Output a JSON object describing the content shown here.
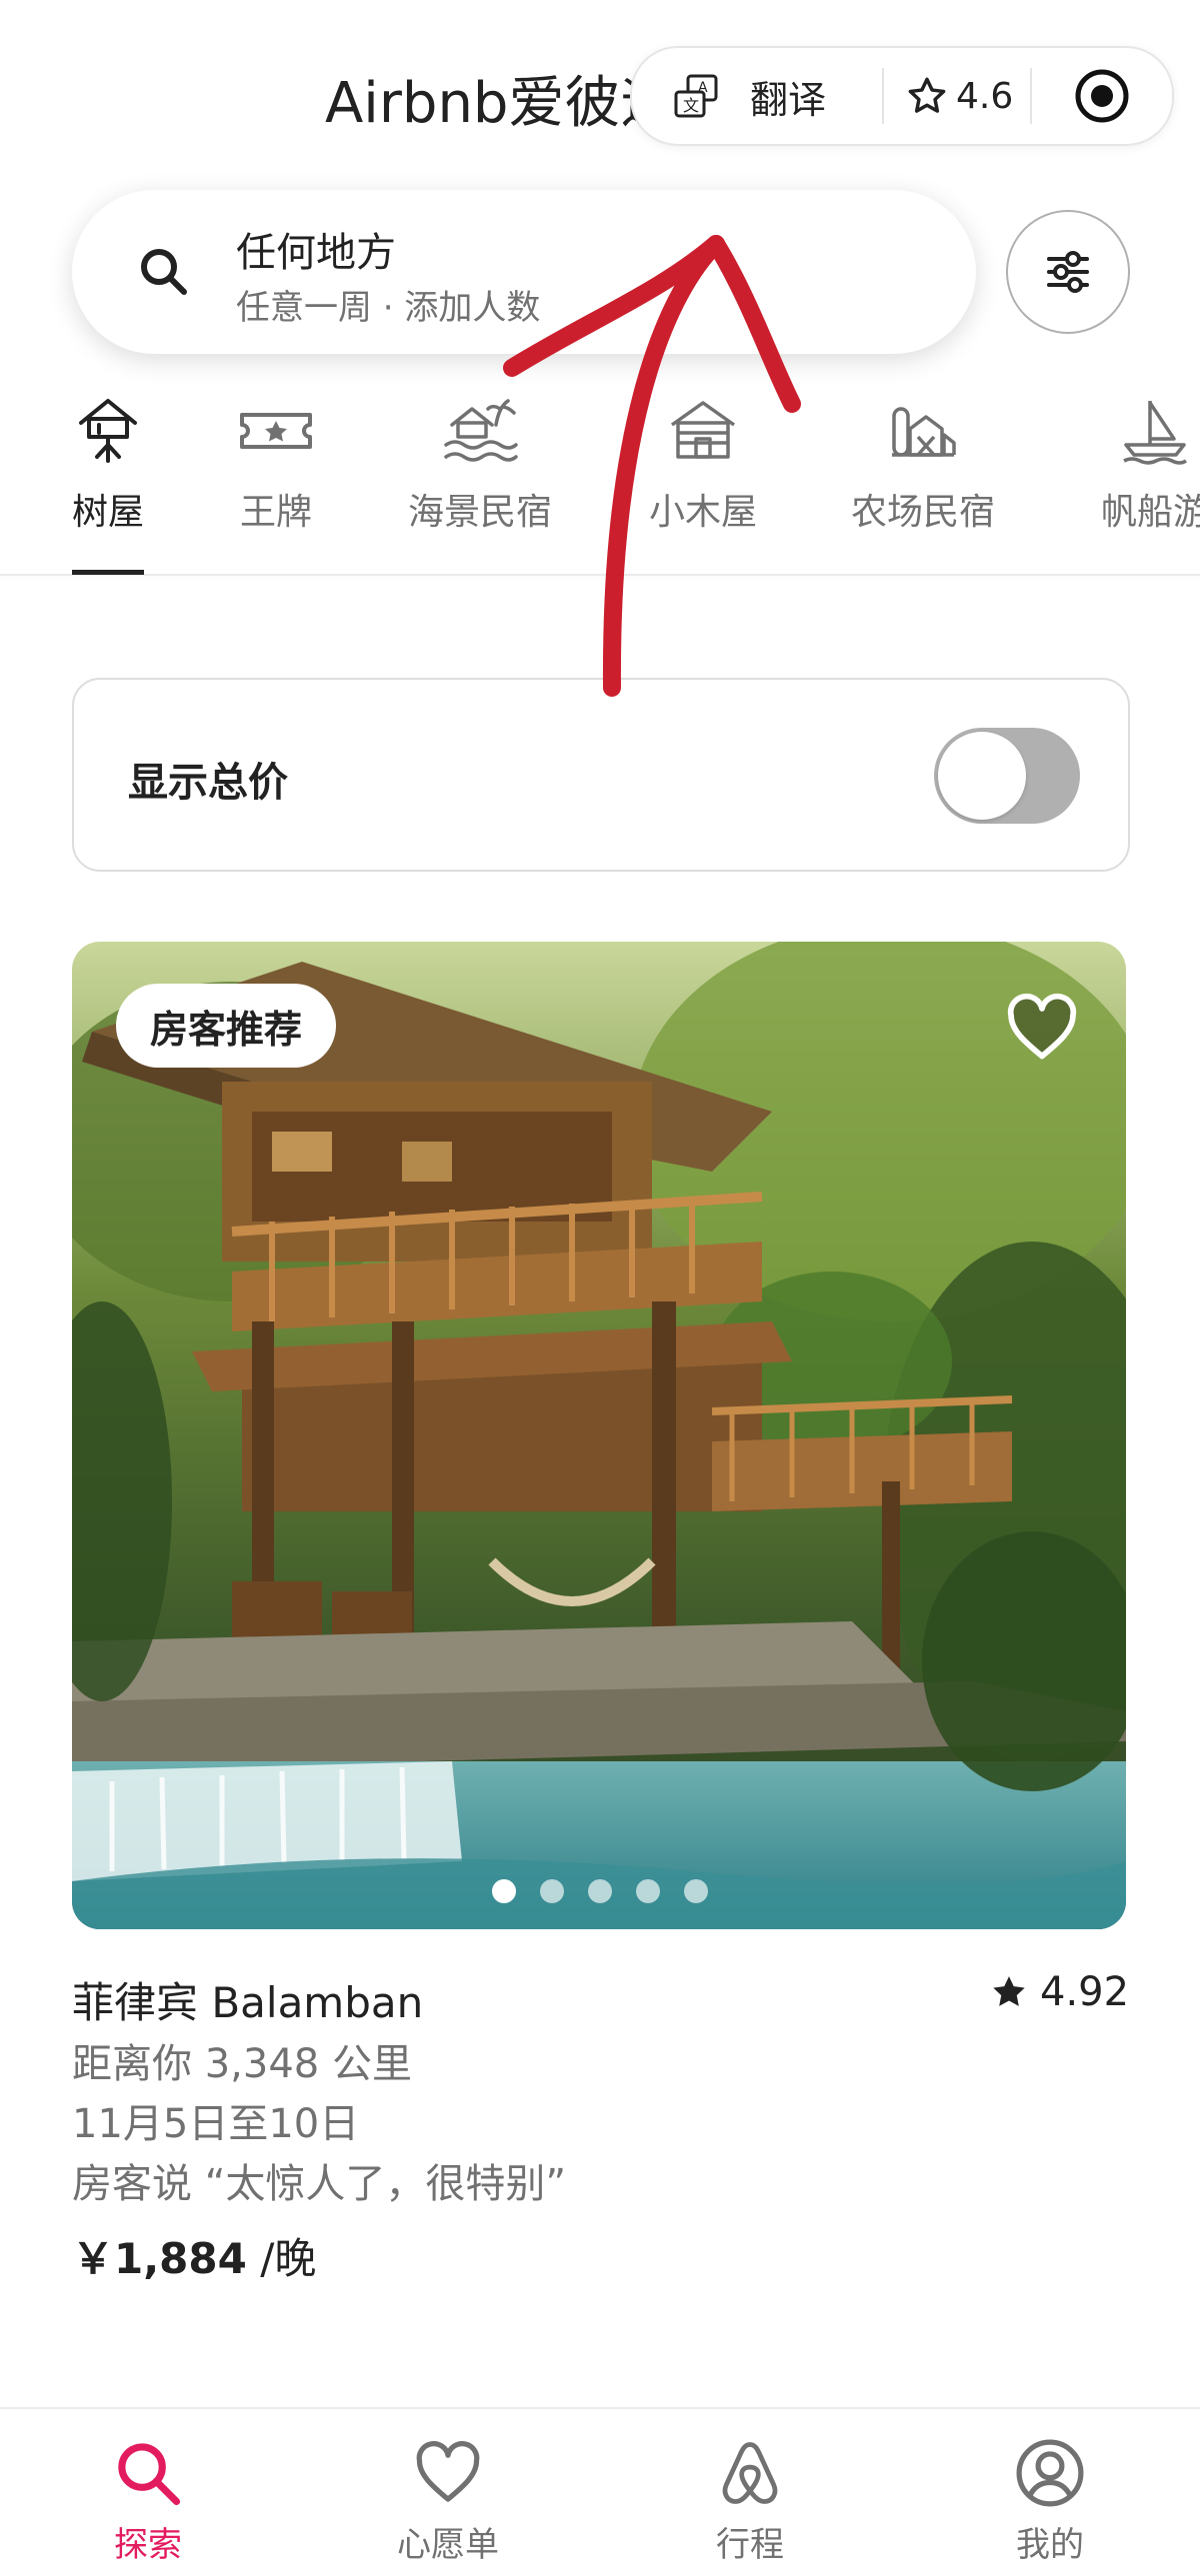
{
  "header": {
    "title": "Airbnb爱彼迎",
    "translate_label": "翻译",
    "rating": "4.6"
  },
  "search": {
    "title": "任何地方",
    "subtitle": "任意一周 · 添加人数"
  },
  "categories": [
    {
      "label": "树屋",
      "icon": "treehouse-icon",
      "active": true
    },
    {
      "label": "王牌",
      "icon": "ticket-star-icon",
      "active": false
    },
    {
      "label": "海景民宿",
      "icon": "beach-house-icon",
      "active": false
    },
    {
      "label": "小木屋",
      "icon": "cabin-icon",
      "active": false
    },
    {
      "label": "农场民宿",
      "icon": "farm-icon",
      "active": false
    },
    {
      "label": "帆船游",
      "icon": "sailboat-icon",
      "active": false
    }
  ],
  "total_price": {
    "label": "显示总价",
    "enabled": false
  },
  "listing": {
    "badge": "房客推荐",
    "location": "菲律宾 Balamban",
    "rating": "4.92",
    "distance": "距离你 3,348 公里",
    "dates": "11月5日至10日",
    "review": "房客说 “太惊人了，很特别”",
    "price": "￥1,884",
    "price_unit": " /晚",
    "photo_count": 5,
    "active_photo": 0
  },
  "nav": [
    {
      "label": "探索",
      "icon": "search-icon",
      "active": true
    },
    {
      "label": "心愿单",
      "icon": "heart-icon",
      "active": false
    },
    {
      "label": "行程",
      "icon": "airbnb-logo-icon",
      "active": false
    },
    {
      "label": "我的",
      "icon": "profile-icon",
      "active": false
    }
  ],
  "colors": {
    "brand": "#e31c5f",
    "annotation": "#cc1f2d",
    "text_primary": "#222222",
    "text_secondary": "#717171"
  }
}
